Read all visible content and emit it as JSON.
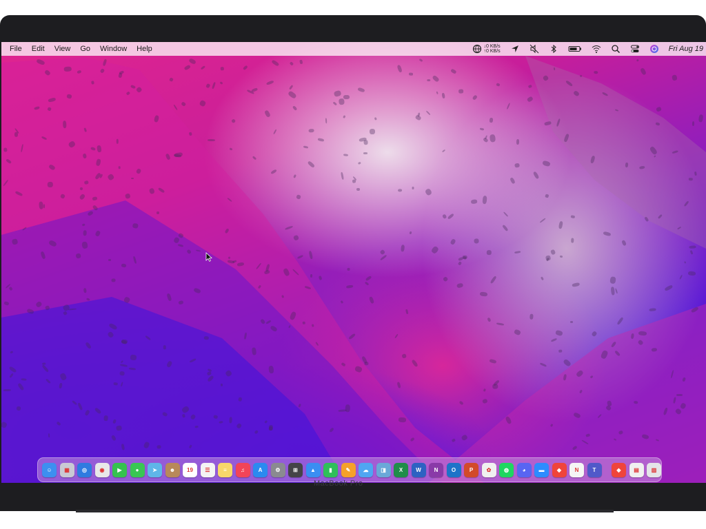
{
  "menubar": {
    "menus": [
      "File",
      "Edit",
      "View",
      "Go",
      "Window",
      "Help"
    ],
    "network": {
      "up": "0 KB/s",
      "down": "0 KB/s"
    },
    "clock": "Fri Aug 19",
    "status_icons": [
      "network-stats-icon",
      "location-icon",
      "mute-icon",
      "bluetooth-icon",
      "battery-icon",
      "wifi-icon",
      "spotlight-search-icon",
      "control-center-icon",
      "siri-icon"
    ]
  },
  "dock": {
    "apps": [
      {
        "name": "finder",
        "color": "#3d8ff0",
        "glyph": "☺"
      },
      {
        "name": "launchpad",
        "color": "#c9c9d4",
        "glyph": "▦"
      },
      {
        "name": "safari",
        "color": "#2f7be0",
        "glyph": "◎"
      },
      {
        "name": "chrome",
        "color": "#e8e8e8",
        "glyph": "◉"
      },
      {
        "name": "facetime",
        "color": "#35c24f",
        "glyph": "▶"
      },
      {
        "name": "messages",
        "color": "#39c653",
        "glyph": "●"
      },
      {
        "name": "maps",
        "color": "#5fb6e8",
        "glyph": "➤"
      },
      {
        "name": "contacts",
        "color": "#b8895a",
        "glyph": "☻"
      },
      {
        "name": "calendar",
        "color": "#ffffff",
        "glyph": "19"
      },
      {
        "name": "reminders",
        "color": "#f4f4f4",
        "glyph": "☰"
      },
      {
        "name": "notes",
        "color": "#f8d76a",
        "glyph": "≡"
      },
      {
        "name": "music",
        "color": "#f24458",
        "glyph": "♫"
      },
      {
        "name": "app-store",
        "color": "#2b8af0",
        "glyph": "A"
      },
      {
        "name": "system-preferences",
        "color": "#8a8a90",
        "glyph": "⚙"
      },
      {
        "name": "calculator",
        "color": "#444448",
        "glyph": "⊞"
      },
      {
        "name": "keynote",
        "color": "#3a8ef2",
        "glyph": "▲"
      },
      {
        "name": "numbers",
        "color": "#2fbf5a",
        "glyph": "▮"
      },
      {
        "name": "pages",
        "color": "#f5a12a",
        "glyph": "✎"
      },
      {
        "name": "icloud",
        "color": "#4fa6f2",
        "glyph": "☁"
      },
      {
        "name": "preview",
        "color": "#6aa8d8",
        "glyph": "◨"
      },
      {
        "name": "excel",
        "color": "#1f8d4a",
        "glyph": "X"
      },
      {
        "name": "word",
        "color": "#2d62c2",
        "glyph": "W"
      },
      {
        "name": "onenote",
        "color": "#8a3aa8",
        "glyph": "N"
      },
      {
        "name": "outlook",
        "color": "#1e73c8",
        "glyph": "O"
      },
      {
        "name": "powerpoint",
        "color": "#d24a2a",
        "glyph": "P"
      },
      {
        "name": "photos",
        "color": "#f0f0f0",
        "glyph": "✿"
      },
      {
        "name": "spotify",
        "color": "#1ed760",
        "glyph": "◍"
      },
      {
        "name": "discord",
        "color": "#5865f2",
        "glyph": "◕"
      },
      {
        "name": "zoom",
        "color": "#2d8cff",
        "glyph": "▬"
      },
      {
        "name": "anydesk",
        "color": "#ef443b",
        "glyph": "◆"
      },
      {
        "name": "news",
        "color": "#f5f5f5",
        "glyph": "N"
      },
      {
        "name": "teams",
        "color": "#5059c9",
        "glyph": "T"
      }
    ],
    "trailing": [
      {
        "name": "anydesk-folder",
        "color": "#ef443b",
        "glyph": "◆"
      },
      {
        "name": "documents-folder",
        "color": "#f0f0f0",
        "glyph": "▤"
      },
      {
        "name": "trash",
        "color": "#e4e4e8",
        "glyph": "▥"
      }
    ]
  },
  "hardware": {
    "brand_label": "MacBook Pro"
  }
}
